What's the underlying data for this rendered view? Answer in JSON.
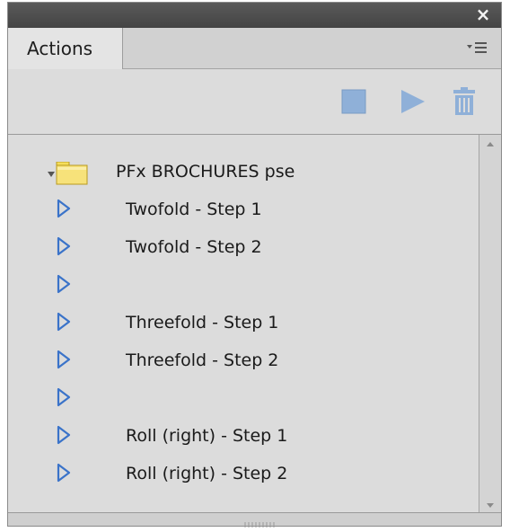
{
  "panel": {
    "close_glyph": "×",
    "tab_label": "Actions"
  },
  "toolbar": {
    "buttons": [
      {
        "name": "stop-icon",
        "color": "#8fb0d8"
      },
      {
        "name": "play-icon",
        "color": "#8fb0d8"
      },
      {
        "name": "trash-icon",
        "color": "#8fb0d8"
      }
    ]
  },
  "actions": {
    "folder": {
      "label": "PFx BROCHURES pse",
      "expanded": true,
      "folder_color": "#f5de59"
    },
    "items": [
      {
        "label": "Twofold - Step 1"
      },
      {
        "label": "Twofold - Step 2"
      },
      {
        "label": ""
      },
      {
        "label": "Threefold - Step 1"
      },
      {
        "label": "Threefold - Step 2"
      },
      {
        "label": ""
      },
      {
        "label": "Roll (right) - Step 1"
      },
      {
        "label": "Roll (right) - Step 2"
      }
    ]
  },
  "colors": {
    "play_outline": "#3a73c9",
    "panel_bg": "#dcdcdc"
  }
}
